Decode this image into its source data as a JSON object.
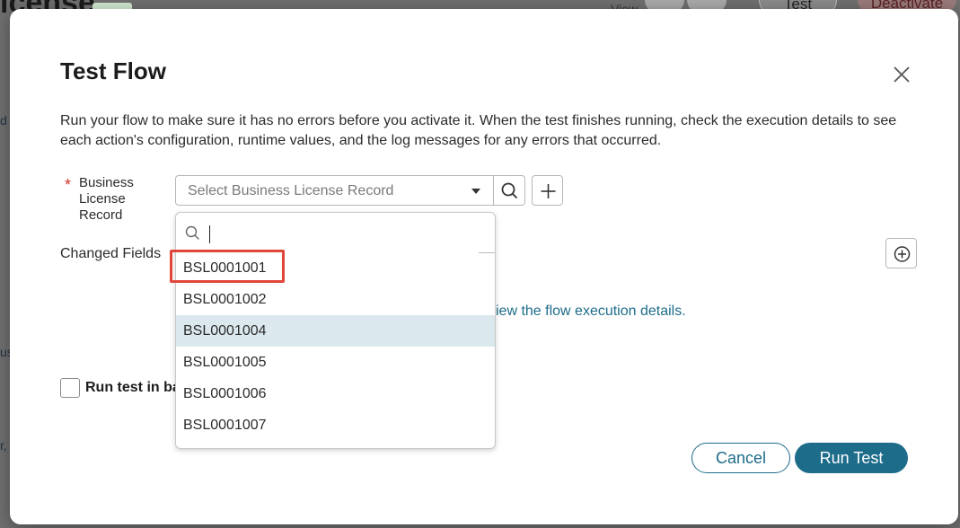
{
  "modal": {
    "title": "Test Flow",
    "description": "Run your flow to make sure it has no errors before you activate it. When the test finishes running, check the execution details to see each action's configuration, runtime values, and the log messages for any errors that occurred.",
    "record_field": {
      "label": "Business License Record",
      "required": true,
      "placeholder": "Select Business License Record"
    },
    "changed_fields_label": "Changed Fields",
    "link_fragment": "iew the flow execution details.",
    "checkbox_label": "Run test in ba",
    "cancel_label": "Cancel",
    "run_label": "Run Test"
  },
  "dropdown": {
    "search_value": "",
    "items": [
      {
        "label": "BSL0001001",
        "highlighted": false,
        "outlined": true
      },
      {
        "label": "BSL0001002",
        "highlighted": false,
        "outlined": false
      },
      {
        "label": "BSL0001004",
        "highlighted": true,
        "outlined": false
      },
      {
        "label": "BSL0001005",
        "highlighted": false,
        "outlined": false
      },
      {
        "label": "BSL0001006",
        "highlighted": false,
        "outlined": false
      },
      {
        "label": "BSL0001007",
        "highlighted": false,
        "outlined": false
      }
    ]
  },
  "background": {
    "title_fragment": "icense",
    "view_label": "View",
    "test_label": "Test",
    "deactivate_label": "Deactivate",
    "left_fragments": [
      "d",
      "us",
      "r,"
    ]
  },
  "colors": {
    "accent": "#1d6c8a",
    "required": "#d0342c",
    "highlight_row": "#dbe9ee",
    "annotation": "#e0473a"
  }
}
